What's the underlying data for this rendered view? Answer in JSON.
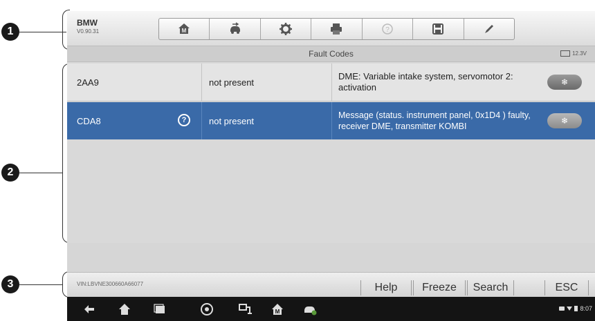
{
  "callouts": [
    "1",
    "2",
    "3"
  ],
  "header": {
    "model": "BMW",
    "version": "V0.90.31"
  },
  "toolbar": {
    "icons": [
      "home-icon",
      "vehicle-swap-icon",
      "settings-icon",
      "print-icon",
      "help-icon",
      "save-icon",
      "edit-icon"
    ]
  },
  "screen": {
    "title": "Fault Codes",
    "voltage": "12.3V"
  },
  "fault_rows": [
    {
      "code": "2AA9",
      "status": "not present",
      "description": "DME: Variable intake system, servomotor 2: activation",
      "selected": false,
      "has_help": false
    },
    {
      "code": "CDA8",
      "status": "not present",
      "description": "Message (status. instrument panel, 0x1D4 ) faulty, receiver DME, transmitter KOMBI",
      "selected": true,
      "has_help": true
    }
  ],
  "freeze_frame_symbol": "❄",
  "help_symbol": "?",
  "footer": {
    "vin": "VIN:LBVNE300660A66077",
    "buttons": {
      "help": "Help",
      "freeze": "Freeze",
      "search": "Search",
      "esc": "ESC"
    }
  },
  "status": {
    "time": "8:07"
  }
}
